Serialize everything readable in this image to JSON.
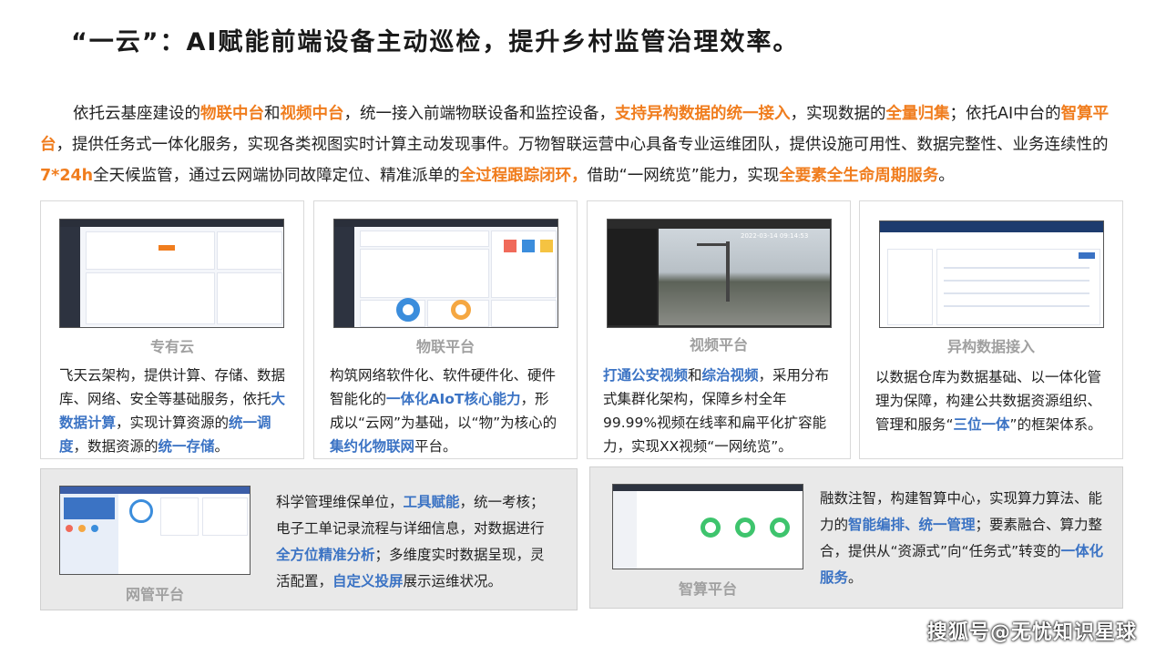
{
  "title": "“一云”：AI赋能前端设备主动巡检，提升乡村监管治理效率。",
  "intro": [
    {
      "t": "依托云基座建设的",
      "h": false
    },
    {
      "t": "物联中台",
      "h": true
    },
    {
      "t": "和",
      "h": false
    },
    {
      "t": "视频中台",
      "h": true
    },
    {
      "t": "，统一接入前端物联设备和监控设备，",
      "h": false
    },
    {
      "t": "支持异构数据的统一接入",
      "h": true
    },
    {
      "t": "，实现数据的",
      "h": false
    },
    {
      "t": "全量归集",
      "h": true
    },
    {
      "t": "；依托AI中台的",
      "h": false
    },
    {
      "t": "智算平台",
      "h": true
    },
    {
      "t": "，提供任务式一体化服务，实现各类视图实时计算主动发现事件。万物智联运营中心具备专业运维团队，提供设施可用性、数据完整性、业务连续性的",
      "h": false
    },
    {
      "t": "7*24h",
      "h": true
    },
    {
      "t": "全天候监管，通过云网端协同故障定位、精准派单的",
      "h": false
    },
    {
      "t": "全过程跟踪闭环，",
      "h": true
    },
    {
      "t": "借助“一网统览”能力，实现",
      "h": false
    },
    {
      "t": "全要素全生命周期服务",
      "h": true
    },
    {
      "t": "。",
      "h": false
    }
  ],
  "cards": {
    "private_cloud": {
      "caption": "专有云",
      "desc": [
        {
          "t": "飞天云架构，提供计算、存储、数据库、网络、安全等基础服务，依托",
          "b": false
        },
        {
          "t": "大数据计算",
          "b": true
        },
        {
          "t": "，实现计算资源的",
          "b": false
        },
        {
          "t": "统一调度",
          "b": true
        },
        {
          "t": "，数据资源的",
          "b": false
        },
        {
          "t": "统一存储",
          "b": true
        },
        {
          "t": "。",
          "b": false
        }
      ]
    },
    "iot_platform": {
      "caption": "物联平台",
      "desc": [
        {
          "t": "构筑网络软件化、软件硬件化、硬件智能化的",
          "b": false
        },
        {
          "t": "一体化AIoT核心能力",
          "b": true
        },
        {
          "t": "，形成以“云网”为基础，以“物”为核心的",
          "b": false
        },
        {
          "t": "集约化物联网",
          "b": true
        },
        {
          "t": "平台。",
          "b": false
        }
      ]
    },
    "video_platform": {
      "caption": "视频平台",
      "timestamp": "2022-03-14 09:14:53",
      "desc": [
        {
          "t": "打通公安视频",
          "b": true
        },
        {
          "t": "和",
          "b": false
        },
        {
          "t": "综治视频",
          "b": true
        },
        {
          "t": "，采用分布式集群化架构，保障乡村全年99.99%视频在线率和扁平化扩容能力，实现XX视频“一网统览”。",
          "b": false
        }
      ]
    },
    "hetero_data": {
      "caption": "异构数据接入",
      "desc": [
        {
          "t": "以数据仓库为数据基础、以一体化管理为保障，构建公共数据资源组织、管理和服务“",
          "b": false
        },
        {
          "t": "三位一体",
          "b": true
        },
        {
          "t": "”的框架体系。",
          "b": false
        }
      ]
    },
    "network_mgmt": {
      "caption": "网管平台",
      "desc": [
        {
          "t": "科学管理维保单位，",
          "b": false
        },
        {
          "t": "工具赋能",
          "b": true
        },
        {
          "t": "，统一考核；电子工单记录流程与详细信息，对数据进行",
          "b": false
        },
        {
          "t": "全方位精准分析",
          "b": true
        },
        {
          "t": "；多维度实时数据呈现，灵活配置，",
          "b": false
        },
        {
          "t": "自定义投屏",
          "b": true
        },
        {
          "t": "展示运维状况。",
          "b": false
        }
      ]
    },
    "compute_platform": {
      "caption": "智算平台",
      "desc": [
        {
          "t": "融数注智，构建智算中心，实现算力算法、能力的",
          "b": false
        },
        {
          "t": "智能编排、统一管理",
          "b": true
        },
        {
          "t": "；要素融合、算力整合，提供从“资源式”向“任务式”转变的",
          "b": false
        },
        {
          "t": "一体化服务",
          "b": true
        },
        {
          "t": "。",
          "b": false
        }
      ]
    }
  },
  "watermark": "搜狐号@无忧知识星球",
  "colors": {
    "highlight_orange": "#f07d1e",
    "highlight_blue": "#3b73c4",
    "caption_gray": "#a0a0a0"
  }
}
